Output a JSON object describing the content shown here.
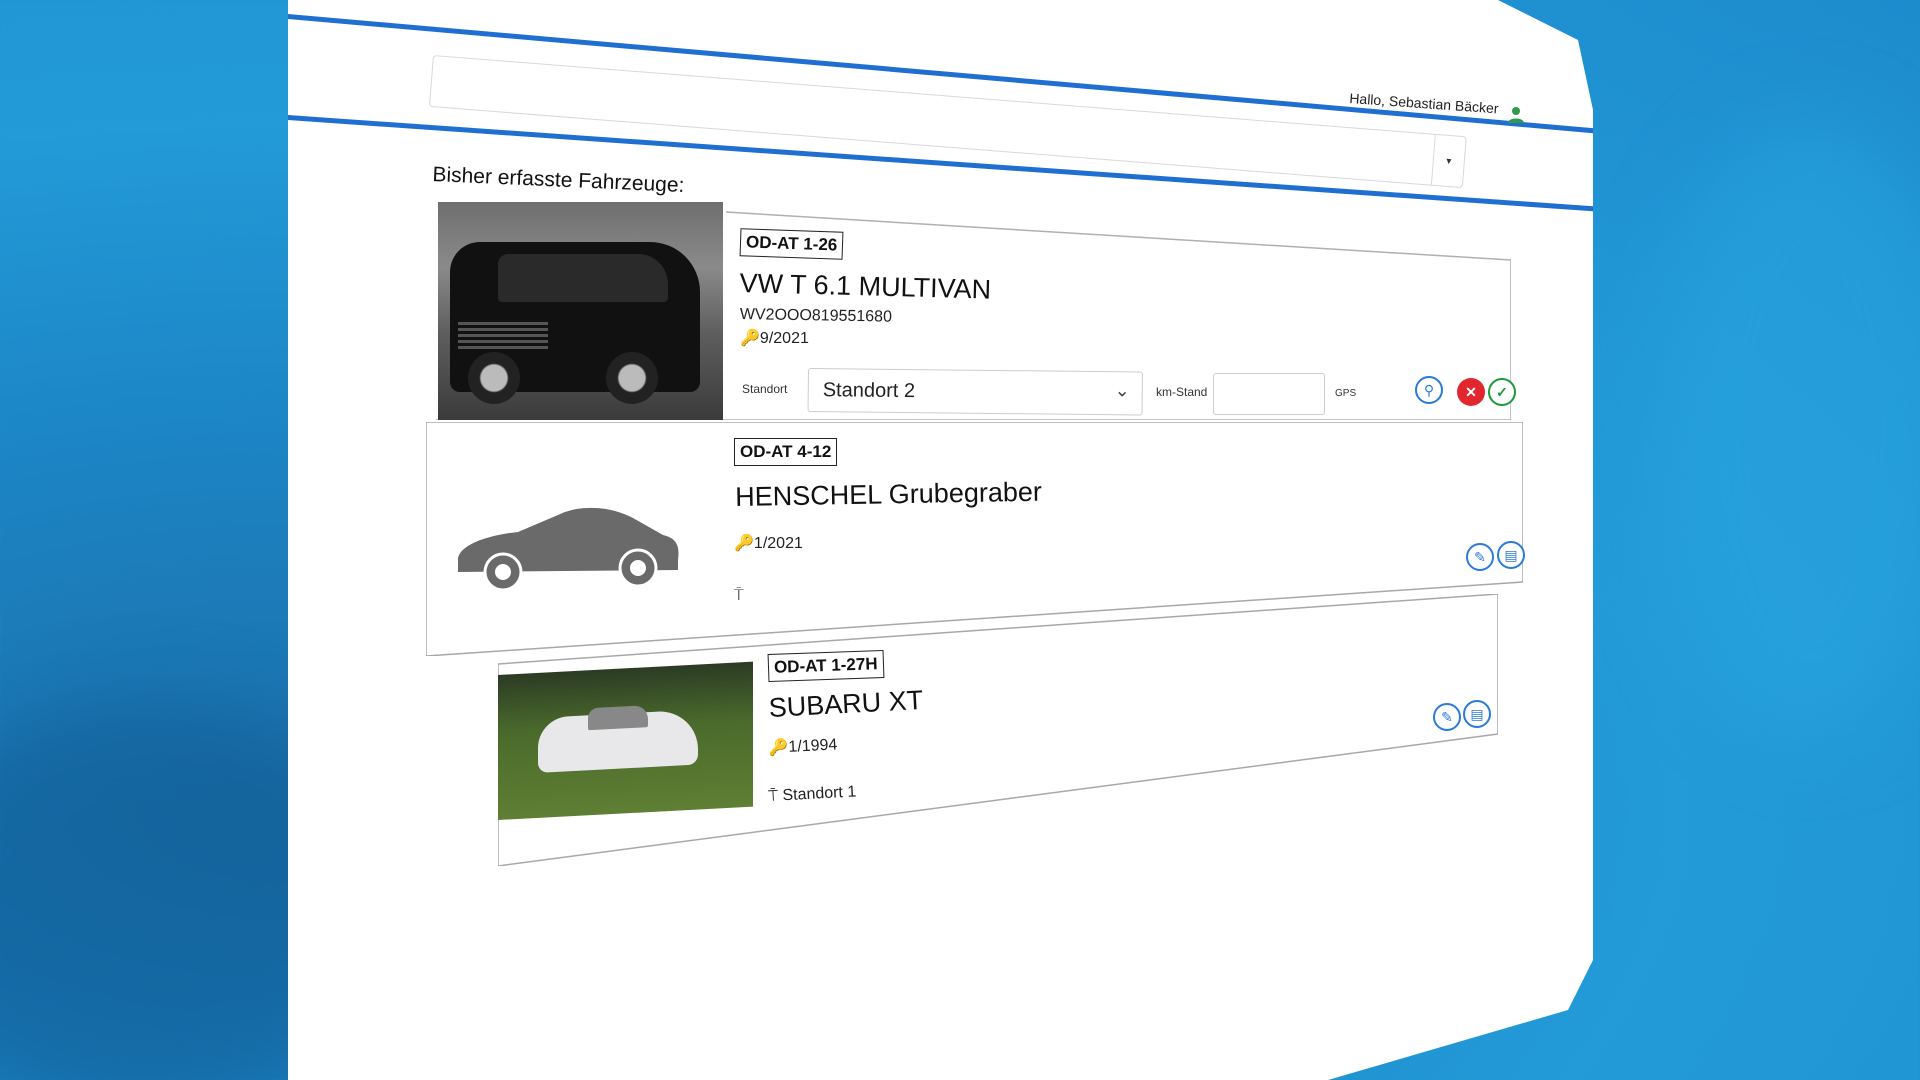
{
  "header": {
    "greeting": "Hallo, Sebastian Bäcker"
  },
  "main": {
    "section_title": "Bisher erfasste Fahrzeuge:"
  },
  "vehicles": [
    {
      "plate": "OD-AT 1-26",
      "name": "VW T 6.1 MULTIVAN",
      "vin": "WV2OOO819551680",
      "date": "9/2021",
      "edit": {
        "standort_label": "Standort",
        "standort_value": "Standort 2",
        "km_label": "km-Stand",
        "km_value": "",
        "gps_label": "GPS"
      }
    },
    {
      "plate": "OD-AT 4-12",
      "name": "HENSCHEL Grubegraber",
      "date": "1/2021",
      "location": ""
    },
    {
      "plate": "OD-AT 1-27H",
      "name": "SUBARU XT",
      "date": "1/1994",
      "location": "Standort 1"
    }
  ],
  "colors": {
    "accent": "#1f6fd1",
    "cancel": "#e2262e",
    "confirm": "#1a9a3a",
    "user_icon": "#2e9a4a"
  },
  "icons": {
    "key": "key-icon",
    "location": "location-pin-icon",
    "edit": "pencil-icon",
    "document": "document-icon",
    "cancel": "close-icon",
    "confirm": "check-icon",
    "user": "user-icon",
    "standort": "t-pin-icon"
  }
}
